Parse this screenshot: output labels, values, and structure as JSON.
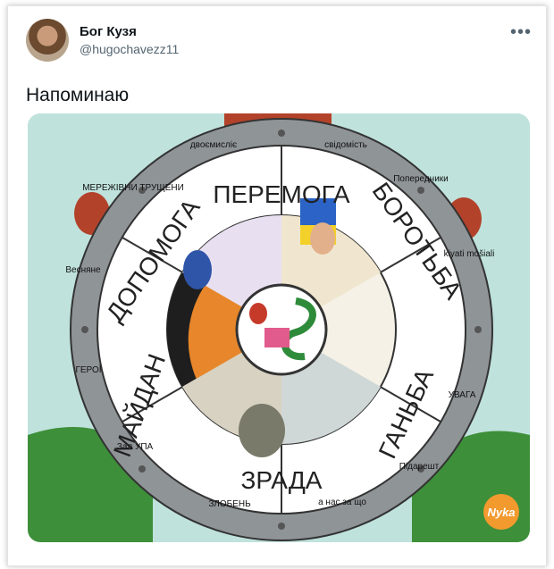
{
  "tweet": {
    "display_name": "Бог Кузя",
    "handle": "@hugochavezz11",
    "more_icon": "more-horizontal-icon",
    "text": "Напоминаю"
  },
  "image": {
    "wheel_words": [
      "ПЕРЕМОГА",
      "БОРОТЬБА",
      "ГАНЬБА",
      "ЗРАДА",
      "МАЙДАН",
      "ДОПОМОГА"
    ],
    "rim_labels": [
      "двоємисліє",
      "свідомість",
      "Попередники",
      "kiyati mošiali",
      "УВАГА",
      "Підарешт",
      "а нас за що",
      "ЗЛОБЕНЬ",
      "Зал УПА",
      "ГЕРОЇ",
      "Весняне",
      "МЕРЕЖІВНИ ТРУЩЕНИ"
    ],
    "watermark": "Nyka"
  },
  "colors": {
    "name": "#0f1419",
    "secondary": "#536471",
    "rim": "#8f9497",
    "sky": "#bfe2dc",
    "grass": "#3e8f3a"
  }
}
